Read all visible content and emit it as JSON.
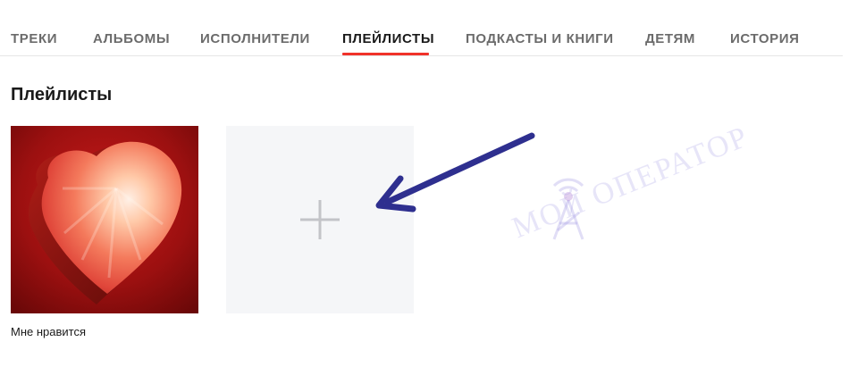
{
  "tabs": [
    {
      "label": "ТРЕКИ",
      "active": false
    },
    {
      "label": "АЛЬБОМЫ",
      "active": false
    },
    {
      "label": "ИСПОЛНИТЕЛИ",
      "active": false
    },
    {
      "label": "ПЛЕЙЛИСТЫ",
      "active": true
    },
    {
      "label": "ПОДКАСТЫ И КНИГИ",
      "active": false
    },
    {
      "label": "ДЕТЯМ",
      "active": false
    },
    {
      "label": "ИСТОРИЯ",
      "active": false
    }
  ],
  "section": {
    "title": "Плейлисты"
  },
  "playlists": [
    {
      "name": "Мне нравится",
      "cover_icon": "heart-icon"
    }
  ],
  "create_card": {
    "icon": "plus-icon"
  },
  "annotation": {
    "icon": "arrow-icon",
    "color": "#2e2f8f"
  },
  "watermark": {
    "text": "МОЙ ОПЕРАТОР",
    "color": "#b4aaf0"
  },
  "colors": {
    "accent": "#f0322a",
    "card_background": "#f5f6f8"
  }
}
